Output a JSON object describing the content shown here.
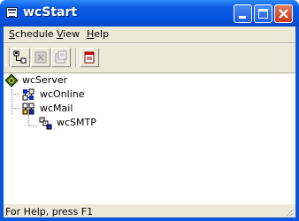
{
  "window": {
    "title": "wcStart"
  },
  "menu": {
    "items": [
      {
        "label": "Schedule",
        "accel": "S",
        "rest": "chedule"
      },
      {
        "label": "View",
        "accel": "V",
        "rest": "iew"
      },
      {
        "label": "Help",
        "accel": "H",
        "rest": "elp"
      }
    ]
  },
  "toolbar": {
    "buttons": [
      {
        "icon": "network-icon",
        "enabled": true
      },
      {
        "icon": "stop-icon",
        "enabled": false
      },
      {
        "icon": "properties-icon",
        "enabled": false
      },
      {
        "icon": "window-icon",
        "enabled": true
      }
    ]
  },
  "tree": {
    "nodes": [
      {
        "label": "wcServer",
        "level": 0,
        "icon": "server-icon"
      },
      {
        "label": "wcOnline",
        "level": 1,
        "icon": "online-service-icon"
      },
      {
        "label": "wcMail",
        "level": 1,
        "icon": "mail-service-icon"
      },
      {
        "label": "wcSMTP",
        "level": 2,
        "icon": "smtp-service-icon"
      }
    ]
  },
  "status": {
    "text": "For Help, press F1"
  }
}
